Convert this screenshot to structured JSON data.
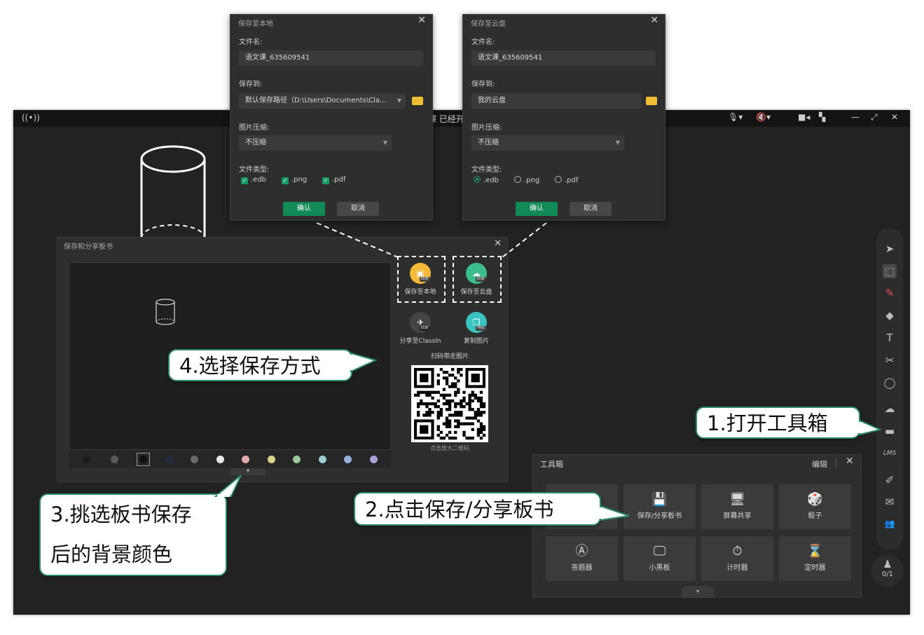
{
  "titlebar": {
    "live_icon": "((•))",
    "partial_text": "课  已经开",
    "mic_icon": "🎙▾",
    "mute_icon": "🔇▾",
    "camera_icon": "■◂",
    "layout_icon": "▚",
    "minimize": "—",
    "restore": "⤢",
    "close": "✕"
  },
  "right_toolbar": {
    "items": [
      {
        "icon": "pointer-icon",
        "glyph": "➤"
      },
      {
        "icon": "select-icon",
        "glyph": "⬚"
      },
      {
        "icon": "pen-icon",
        "glyph": "✎"
      },
      {
        "icon": "eraser-icon",
        "glyph": "◆"
      },
      {
        "icon": "text-icon",
        "glyph": "T"
      },
      {
        "icon": "scissors-icon",
        "glyph": "✂"
      },
      {
        "icon": "shape-icon",
        "glyph": "◯"
      },
      {
        "icon": "cloud-icon",
        "glyph": "☁"
      },
      {
        "icon": "toolbox-icon",
        "glyph": "▬"
      },
      {
        "icon": "lms-icon",
        "glyph": "LMS"
      },
      {
        "icon": "edit-icon",
        "glyph": "✐"
      },
      {
        "icon": "chat-icon",
        "glyph": "✉"
      },
      {
        "icon": "users-icon",
        "glyph": "👥"
      }
    ],
    "seat_count": "0/1"
  },
  "save_dialog": {
    "title": "保存和分享板书",
    "close": "✕",
    "expand": "▾",
    "swatches": [
      "#1a1a1a",
      "#5a5a5a",
      "#0f0f0f",
      "#232a3c",
      "#6a6a6a",
      "#e8e8e8",
      "#e2a8ac",
      "#d8d48a",
      "#9ec89e",
      "#9ecdd0",
      "#9ab0d8",
      "#aaa2d6"
    ],
    "share_options": [
      {
        "label": "保存至本地",
        "icon": "local-save-icon",
        "tag": "EDB",
        "color": "#f4b93a"
      },
      {
        "label": "保存至云盘",
        "icon": "cloud-save-icon",
        "tag": "EDB",
        "color": "#3dbd8c"
      },
      {
        "label": "分享至ClassIn",
        "icon": "classin-share-icon",
        "tag": "EDB",
        "color": "#444444"
      },
      {
        "label": "复制图片",
        "icon": "copy-image-icon",
        "tag": "PNG",
        "color": "#3cc3c0"
      }
    ],
    "qr_title": "扫码带走图片",
    "qr_hint": "点击放大二维码"
  },
  "local_dialog": {
    "title": "保存至本地",
    "close": "✕",
    "filename_label": "文件名:",
    "filename_value": "语文课_635609541",
    "saveto_label": "保存到:",
    "saveto_value": "默认保存路径（D:\\Users\\Documents\\Cla...",
    "compress_label": "图片压缩:",
    "compress_value": "不压缩",
    "filetype_label": "文件类型:",
    "types": [
      ".edb",
      ".png",
      ".pdf"
    ],
    "ok": "确认",
    "cancel": "取消"
  },
  "cloud_dialog": {
    "title": "保存至云盘",
    "close": "✕",
    "filename_label": "文件名:",
    "filename_value": "语文课_635609541",
    "saveto_label": "保存到:",
    "saveto_value": "我的云盘",
    "compress_label": "图片压缩:",
    "compress_value": "不压缩",
    "filetype_label": "文件类型:",
    "types": [
      ".edb",
      ".png",
      ".pdf"
    ],
    "selected_type": ".edb",
    "ok": "确认",
    "cancel": "取消"
  },
  "toolbox": {
    "title": "工具箱",
    "edit": "编辑",
    "close": "✕",
    "expand": "▾",
    "tiles": [
      {
        "label": "",
        "icon": "hidden-tool-icon",
        "glyph": ""
      },
      {
        "label": "保存/分享板书",
        "icon": "save-share-icon",
        "glyph": "💾"
      },
      {
        "label": "屏幕共享",
        "icon": "screen-share-icon",
        "glyph": "🖥"
      },
      {
        "label": "骰子",
        "icon": "dice-icon",
        "glyph": "🎲"
      },
      {
        "label": "答题器",
        "icon": "answer-icon",
        "glyph": "Ⓐ"
      },
      {
        "label": "小黑板",
        "icon": "blackboard-icon",
        "glyph": "🖵"
      },
      {
        "label": "计时器",
        "icon": "stopwatch-icon",
        "glyph": "⏱"
      },
      {
        "label": "定时器",
        "icon": "hourglass-icon",
        "glyph": "⌛"
      }
    ]
  },
  "callouts": {
    "step1": "1.打开工具箱",
    "step2": "2.点击保存/分享板书",
    "step3_line1": "3.挑选板书保存",
    "step3_line2": "后的背景颜色",
    "step4": "4.选择保存方式"
  },
  "colors": {
    "accent_green": "#128a57",
    "callout_border": "#2a8a6a",
    "folder_yellow": "#f2bd36"
  }
}
